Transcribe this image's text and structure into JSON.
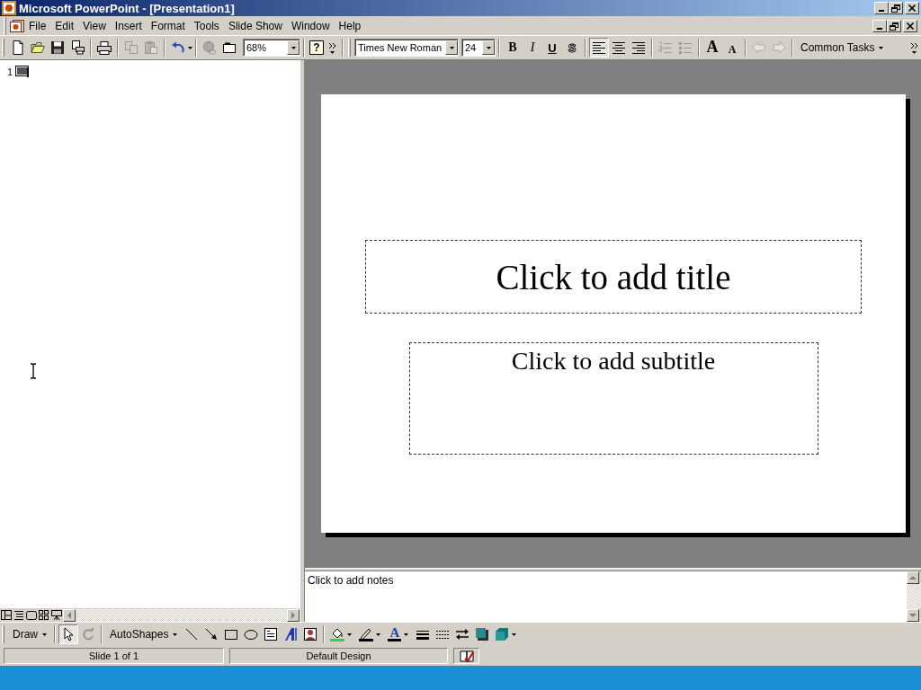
{
  "window": {
    "title": "Microsoft PowerPoint - [Presentation1]"
  },
  "menu_bar": {
    "items": [
      "File",
      "Edit",
      "View",
      "Insert",
      "Format",
      "Tools",
      "Slide Show",
      "Window",
      "Help"
    ]
  },
  "standard_toolbar": {
    "zoom": "68%",
    "help_button": "?"
  },
  "formatting_toolbar": {
    "font": "Times New Roman",
    "size": "24",
    "style_buttons": [
      "B",
      "I",
      "U",
      "S"
    ],
    "alignment": [
      {
        "selected": true
      },
      {
        "selected": false
      },
      {
        "selected": false
      }
    ],
    "font_size_buttons": [
      {
        "label": "A",
        "kind": "grow"
      },
      {
        "label": "A",
        "kind": "shrink"
      }
    ],
    "common_tasks": "Common Tasks"
  },
  "outline": {
    "slides": [
      {
        "number": "1"
      }
    ]
  },
  "slide": {
    "title_text": "Click to add title",
    "subtitle_text": "Click to add subtitle"
  },
  "notes": {
    "text": "Click to add notes"
  },
  "drawing_toolbar": {
    "draw": "Draw",
    "select_tool": {
      "selected": true
    },
    "autoshapes": "AutoShapes",
    "font_color": "A"
  },
  "status_bar": {
    "panels": [
      "Slide 1 of 1",
      "Default Design"
    ]
  }
}
